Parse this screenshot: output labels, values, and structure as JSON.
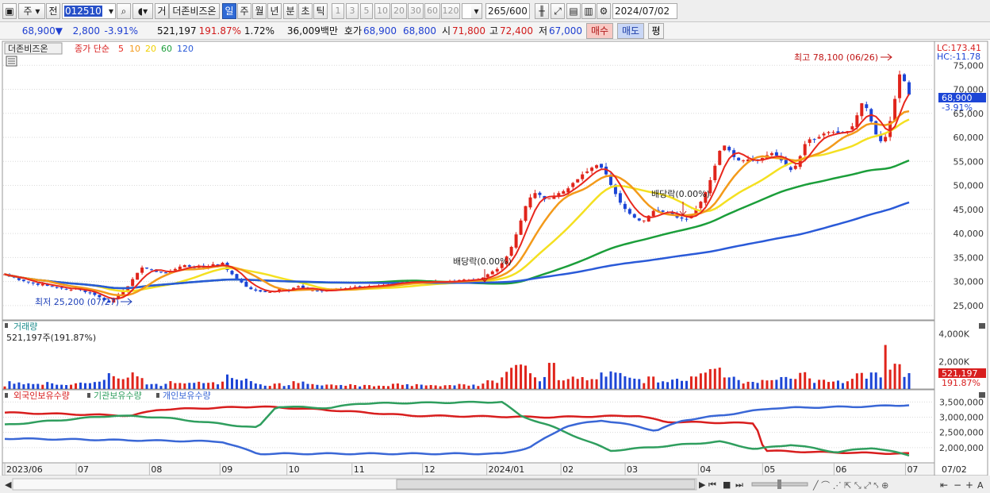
{
  "toolbar": {
    "stock_type": "주",
    "all_label": "전",
    "code": "012510",
    "trade_label": "거",
    "name": "더존비즈온",
    "periods": [
      {
        "label": "일",
        "active": true
      },
      {
        "label": "주",
        "active": false
      },
      {
        "label": "월",
        "active": false
      },
      {
        "label": "년",
        "active": false
      },
      {
        "label": "분",
        "active": false
      },
      {
        "label": "초",
        "active": false
      },
      {
        "label": "틱",
        "active": false
      }
    ],
    "intervals": [
      "1",
      "3",
      "5",
      "10",
      "20",
      "30",
      "60",
      "120"
    ],
    "count": "265",
    "count_total": "/600",
    "date": "2024/07/02"
  },
  "quote": {
    "price": "68,900",
    "arrow": "▼",
    "change": "2,800",
    "change_pct": "-3.91%",
    "volume": "521,197",
    "volume_ratio": "191.87%",
    "turnover_pct": "1.72%",
    "trade_value": "36,009백만",
    "bid_label": "호가",
    "ask_price": "68,900",
    "bid_price": "68,800",
    "open_label": "시",
    "open": "71,800",
    "high_label": "고",
    "high": "72,400",
    "low_label": "저",
    "low": "67,000",
    "buy_label": "매수",
    "sell_label": "매도",
    "eval_label": "평"
  },
  "legend": {
    "stock_name": "더존비즈온",
    "ma_label": "종가 단순",
    "ma_periods": [
      {
        "label": "5",
        "color": "#e8271d"
      },
      {
        "label": "10",
        "color": "#f39a1a"
      },
      {
        "label": "20",
        "color": "#f4e021"
      },
      {
        "label": "60",
        "color": "#1b9e3a"
      },
      {
        "label": "120",
        "color": "#2a5ad8"
      }
    ]
  },
  "annotations": {
    "lc": "LC:173.41",
    "hc": "HC:-11.78",
    "high_note": "최고 78,100 (06/26)",
    "low_note": "최저 25,200 (07/27)",
    "div1": "배당락(0.00%)",
    "div2": "배당락(0.00%)",
    "price_tag": "68,900",
    "price_tag_pct": "-3.91%"
  },
  "volume_panel": {
    "title": "거래량",
    "summary": "521,197주(191.87%)",
    "tag": "521,197",
    "tag_pct": "191.87%"
  },
  "holdings_panel": {
    "labels": [
      "외국인보유수량",
      "기관보유수량",
      "개인보유수량"
    ],
    "colors": [
      "#d81e1e",
      "#2f9e5e",
      "#3a67d6"
    ]
  },
  "price_axis": [
    "75,000",
    "70,000",
    "65,000",
    "60,000",
    "55,000",
    "50,000",
    "45,000",
    "40,000",
    "35,000",
    "30,000",
    "25,000"
  ],
  "volume_axis": [
    "4,000K",
    "2,000K"
  ],
  "holdings_axis": [
    "3,500,000",
    "3,000,000",
    "2,500,000",
    "2,000,000"
  ],
  "x_axis": [
    "2023/06",
    "07",
    "08",
    "09",
    "10",
    "11",
    "12",
    "2024/01",
    "02",
    "03",
    "04",
    "05",
    "06",
    "07"
  ],
  "x_axis_right": "07/02",
  "colors": {
    "up": "#e0241b",
    "down": "#1c45d6",
    "bg": "#ffffff",
    "grid": "#dadada"
  },
  "chart_data": {
    "type": "candlestick",
    "title": "더존비즈온",
    "yrange": [
      22000,
      80000
    ],
    "price_ticks": [
      25000,
      30000,
      35000,
      40000,
      45000,
      50000,
      55000,
      60000,
      65000,
      70000,
      75000
    ],
    "series": [
      {
        "name": "종가",
        "values": [
          31500,
          31000,
          30800,
          30300,
          30100,
          29900,
          29600,
          29300,
          29500,
          29100,
          28900,
          28700,
          28600,
          28400,
          28300,
          28600,
          28200,
          27800,
          27600,
          27200,
          26700,
          26100,
          25600,
          26500,
          27300,
          28100,
          29000,
          30500,
          31800,
          32900,
          32700,
          32400,
          32000,
          31900,
          31700,
          32200,
          32600,
          33100,
          33400,
          33100,
          32800,
          33300,
          32900,
          33200,
          33600,
          33400,
          33900,
          32400,
          31500,
          30600,
          29800,
          28900,
          28400,
          28100,
          27900,
          27800,
          27800,
          28000,
          28400,
          28300,
          28100,
          28700,
          29000,
          28600,
          28300,
          28200,
          28000,
          28000,
          28100,
          28300,
          28400,
          28500,
          28600,
          28700,
          28900,
          28900,
          28900,
          29100,
          29100,
          29200,
          29300,
          29400,
          29700,
          29900,
          29900,
          29800,
          29900,
          30000,
          29900,
          29800,
          29900,
          30000,
          30000,
          29900,
          30000,
          30000,
          30300,
          30400,
          30300,
          30400,
          30500,
          30800,
          31500,
          32100,
          32600,
          33800,
          35200,
          37200,
          39800,
          42700,
          45700,
          47500,
          48400,
          48000,
          47100,
          47300,
          47800,
          48400,
          48800,
          49400,
          50500,
          51300,
          52300,
          52900,
          53700,
          54200,
          53700,
          52300,
          50100,
          48200,
          46400,
          45100,
          44100,
          43300,
          42700,
          42700,
          43700,
          44700,
          44700,
          44500,
          44300,
          43900,
          43300,
          43100,
          42900,
          43900,
          45100,
          46600,
          48600,
          51100,
          54100,
          57200,
          58300,
          57300,
          55900,
          55200,
          55200,
          55400,
          55100,
          55200,
          55700,
          56300,
          56700,
          56200,
          55200,
          54100,
          53200,
          54100,
          56100,
          58600,
          59600,
          59600,
          60100,
          60800,
          61100,
          61100,
          60800,
          60900,
          61300,
          62300,
          64600,
          67100,
          66100,
          63300,
          60600,
          59200,
          60100,
          63400,
          68000,
          73100,
          71700,
          68900
        ]
      },
      {
        "name": "5",
        "values": []
      },
      {
        "name": "10",
        "values": []
      },
      {
        "name": "20",
        "values": []
      },
      {
        "name": "60",
        "values": []
      },
      {
        "name": "120",
        "values": []
      }
    ],
    "volume": {
      "ymax": 4500,
      "unit": "K",
      "ticks": [
        2000,
        4000
      ]
    },
    "holdings": {
      "yrange": [
        1500000,
        3900000
      ],
      "ticks": [
        2000000,
        2500000,
        3000000,
        3500000
      ]
    }
  }
}
